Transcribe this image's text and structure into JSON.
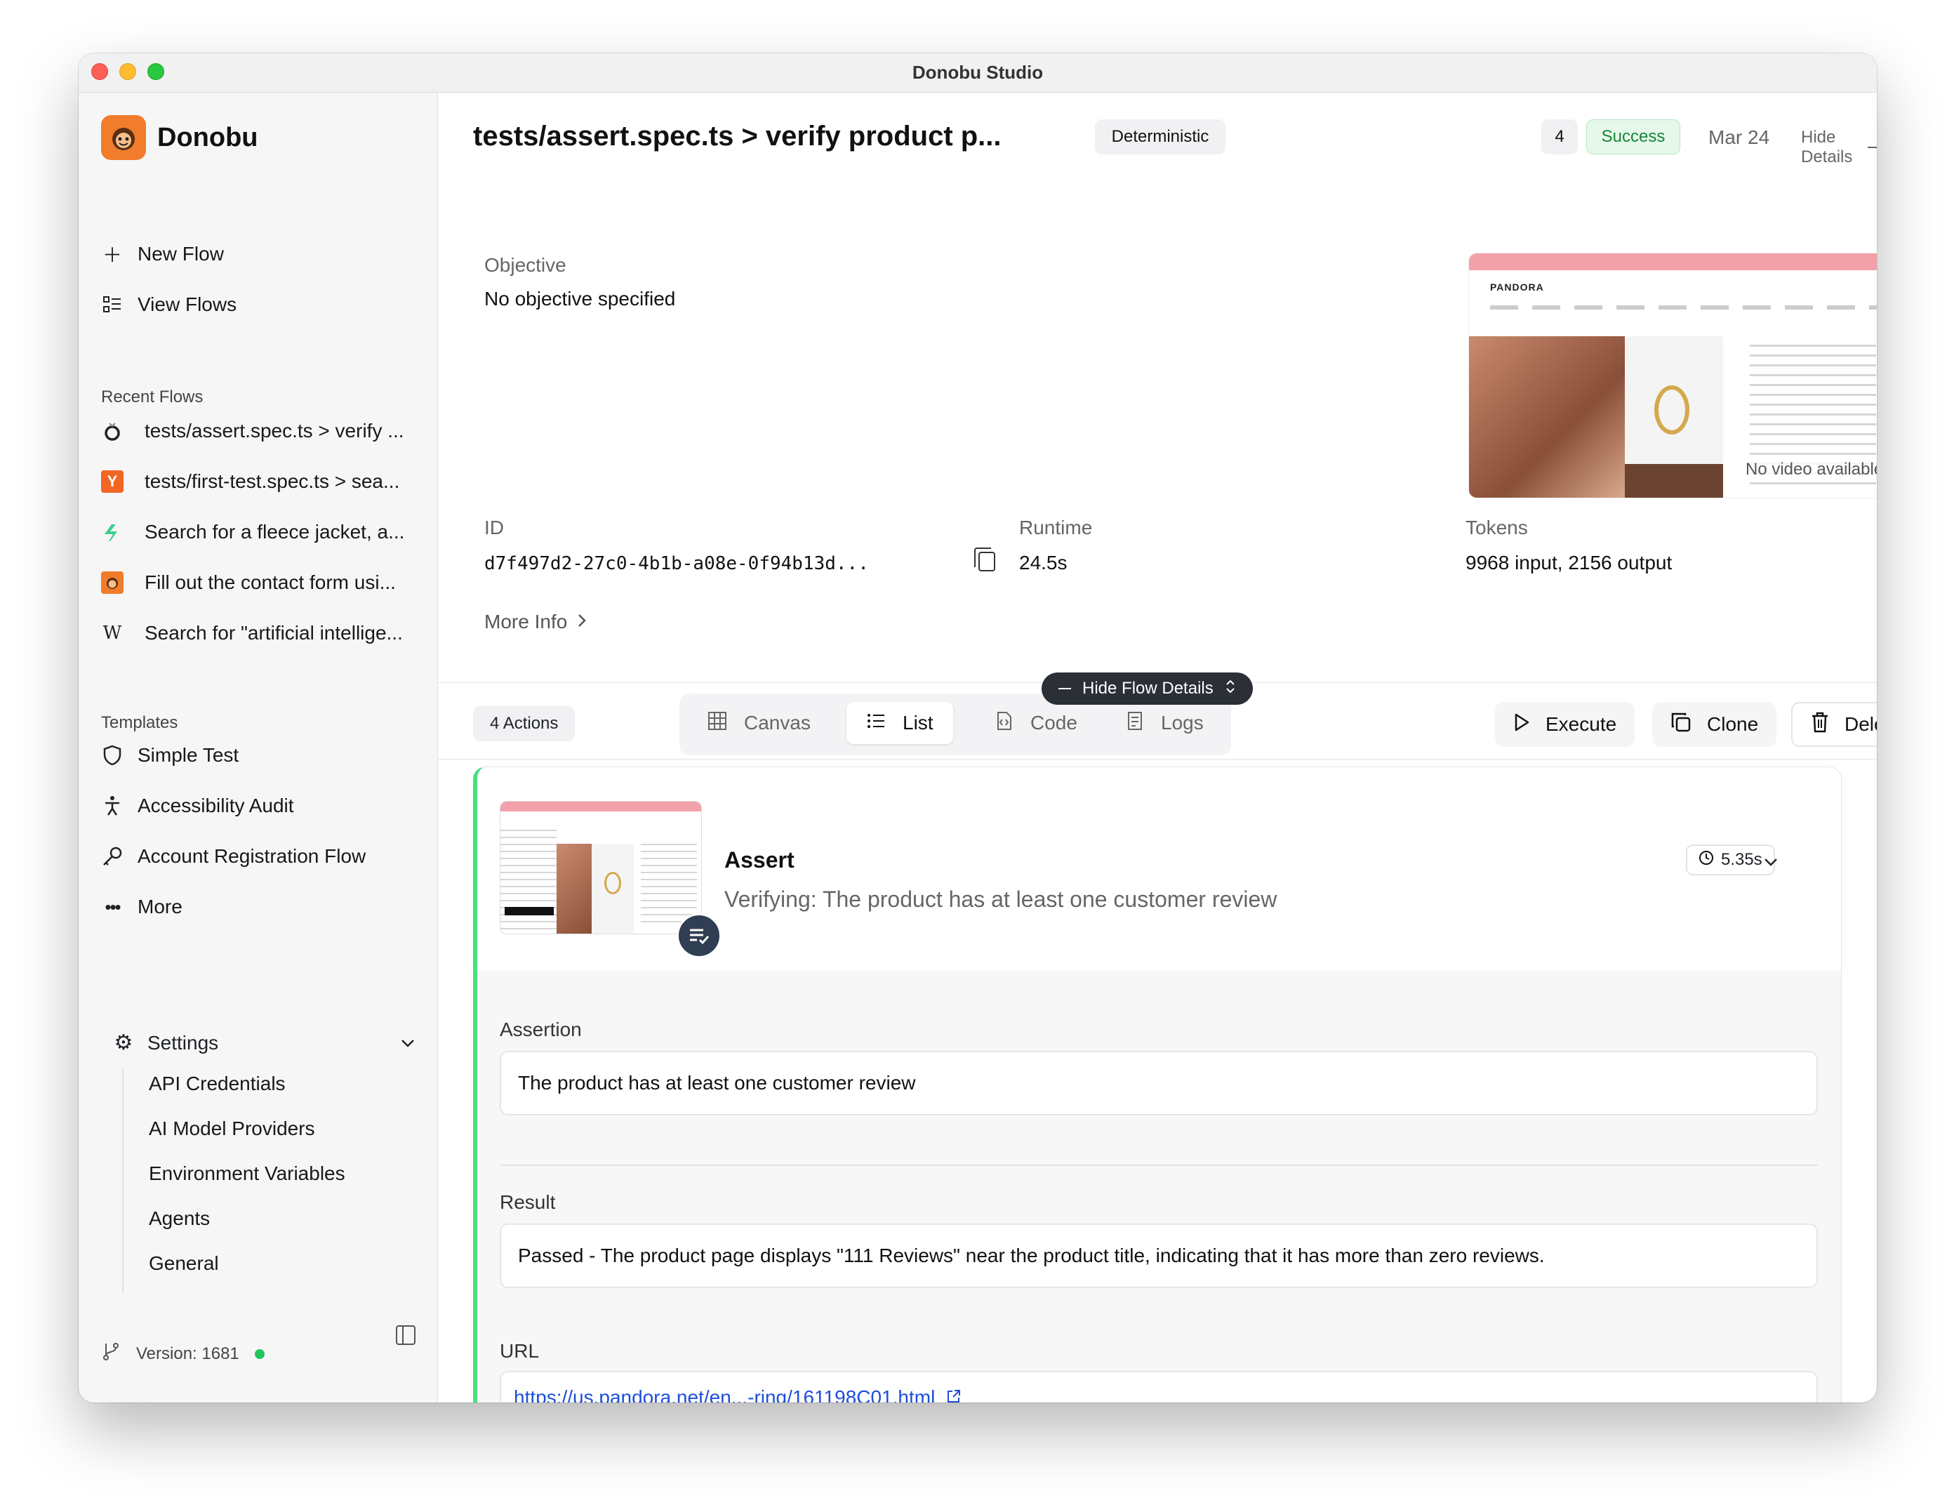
{
  "window": {
    "title": "Donobu Studio"
  },
  "sidebar": {
    "brand": "Donobu",
    "new_flow": "New Flow",
    "view_flows": "View Flows",
    "recent_label": "Recent Flows",
    "recent": [
      {
        "icon": "ring-icon",
        "label": "tests/assert.spec.ts > verify ..."
      },
      {
        "icon": "y-icon",
        "label": "tests/first-test.spec.ts > sea..."
      },
      {
        "icon": "leaf-icon",
        "label": "Search for a fleece jacket, a..."
      },
      {
        "icon": "donobu-icon",
        "label": "Fill out the contact form usi..."
      },
      {
        "icon": "wikipedia-icon",
        "label": "Search for \"artificial intellige..."
      }
    ],
    "templates_label": "Templates",
    "templates": [
      {
        "icon": "shield-icon",
        "label": "Simple Test"
      },
      {
        "icon": "accessibility-icon",
        "label": "Accessibility Audit"
      },
      {
        "icon": "key-icon",
        "label": "Account Registration Flow"
      },
      {
        "icon": "ellipsis-icon",
        "label": "More"
      }
    ],
    "settings": {
      "label": "Settings",
      "items": [
        "API Credentials",
        "AI Model Providers",
        "Environment Variables",
        "Agents",
        "General"
      ]
    },
    "version": "Version: 1681"
  },
  "header": {
    "title": "tests/assert.spec.ts > verify product p...",
    "mode": "Deterministic",
    "count": "4",
    "status": "Success",
    "date": "Mar 24",
    "hide_details": "Hide Details"
  },
  "details": {
    "objective_label": "Objective",
    "objective": "No objective specified",
    "id_label": "ID",
    "id": "d7f497d2-27c0-4b1b-a08e-0f94b13d...",
    "runtime_label": "Runtime",
    "runtime": "24.5s",
    "tokens_label": "Tokens",
    "tokens": "9968 input, 2156 output",
    "more_info": "More Info",
    "preview_brand": "PANDORA",
    "no_video": "No video available"
  },
  "toolbar": {
    "hide_flow_details": "Hide Flow Details",
    "actions": "4 Actions",
    "tabs": [
      "Canvas",
      "List",
      "Code",
      "Logs"
    ],
    "active_tab": "List",
    "execute": "Execute",
    "clone": "Clone",
    "delete": "Delete"
  },
  "action_card": {
    "title": "Assert",
    "subtitle": "Verifying: The product has at least one customer review",
    "duration": "5.35s",
    "assertion_label": "Assertion",
    "assertion": "The product has at least one customer review",
    "result_label": "Result",
    "result": "Passed - The product page displays \"111 Reviews\" near the product title, indicating that it has more than zero reviews.",
    "url_label": "URL",
    "url": "https://us.pandora.net/en...-ring/161198C01.html"
  },
  "colors": {
    "accent_green": "#4ade80",
    "success_text": "#16863a",
    "link": "#1d4ed8",
    "brand_orange": "#f07c2c"
  }
}
